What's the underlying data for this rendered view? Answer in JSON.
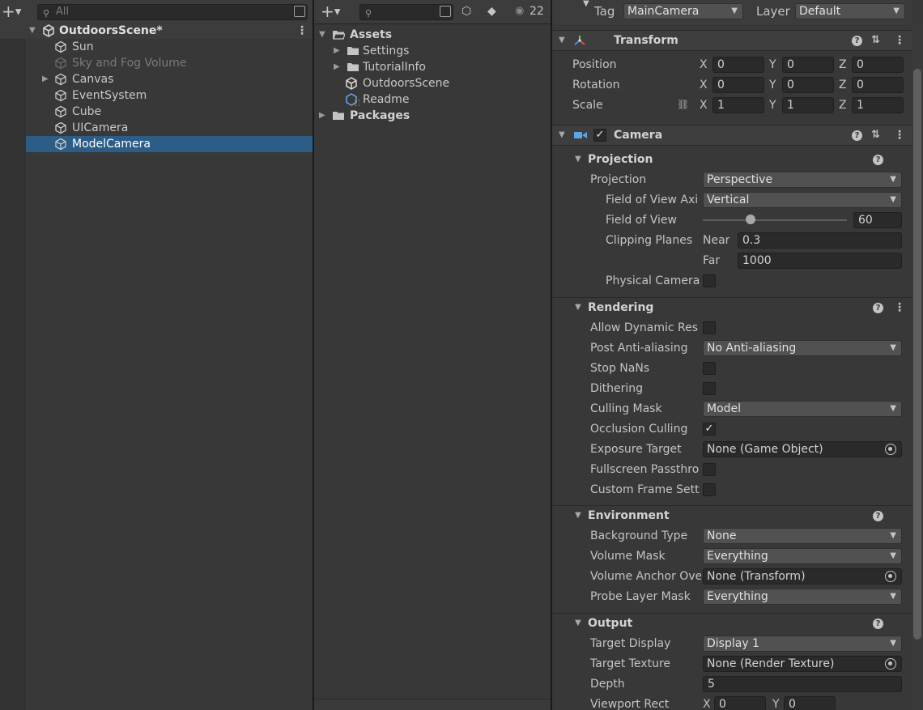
{
  "hierarchy": {
    "search_placeholder": "All",
    "scene": "OutdoorsScene*",
    "items": [
      {
        "label": "Sun",
        "dim": false,
        "has_children": false
      },
      {
        "label": "Sky and Fog Volume",
        "dim": true,
        "has_children": false
      },
      {
        "label": "Canvas",
        "dim": false,
        "has_children": true
      },
      {
        "label": "EventSystem",
        "dim": false,
        "has_children": false
      },
      {
        "label": "Cube",
        "dim": false,
        "has_children": false
      },
      {
        "label": "UICamera",
        "dim": false,
        "has_children": false
      },
      {
        "label": "ModelCamera",
        "dim": false,
        "has_children": false,
        "selected": true
      }
    ]
  },
  "project": {
    "hidden_count": "22",
    "tree": {
      "assets": "Assets",
      "settings": "Settings",
      "tutorialinfo": "TutorialInfo",
      "outdoorsscene": "OutdoorsScene",
      "readme": "Readme",
      "packages": "Packages"
    }
  },
  "inspector": {
    "tag_label": "Tag",
    "tag_value": "MainCamera",
    "layer_label": "Layer",
    "layer_value": "Default",
    "transform": {
      "title": "Transform",
      "position_label": "Position",
      "rotation_label": "Rotation",
      "scale_label": "Scale",
      "axis_x": "X",
      "axis_y": "Y",
      "axis_z": "Z",
      "position": [
        "0",
        "0",
        "0"
      ],
      "rotation": [
        "0",
        "0",
        "0"
      ],
      "scale": [
        "1",
        "1",
        "1"
      ]
    },
    "camera": {
      "title": "Camera",
      "enabled": true,
      "projection": {
        "title": "Projection",
        "projection_label": "Projection",
        "projection_value": "Perspective",
        "fov_axis_label": "Field of View Axi",
        "fov_axis_value": "Vertical",
        "fov_label": "Field of View",
        "fov_value": "60",
        "fov_slider_min": 0,
        "fov_slider_max": 180,
        "clipping_label": "Clipping Planes",
        "near_label": "Near",
        "near_value": "0.3",
        "far_label": "Far",
        "far_value": "1000",
        "physical_label": "Physical Camera",
        "physical_checked": false
      },
      "rendering": {
        "title": "Rendering",
        "allow_dynamic_label": "Allow Dynamic Res",
        "post_aa_label": "Post Anti-aliasing",
        "post_aa_value": "No Anti-aliasing",
        "stop_nans_label": "Stop NaNs",
        "dithering_label": "Dithering",
        "culling_mask_label": "Culling Mask",
        "culling_mask_value": "Model",
        "occlusion_label": "Occlusion Culling",
        "occlusion_checked": true,
        "exposure_label": "Exposure Target",
        "exposure_value": "None (Game Object)",
        "fullscreen_label": "Fullscreen Passthro",
        "custom_frame_label": "Custom Frame Sett"
      },
      "environment": {
        "title": "Environment",
        "bg_type_label": "Background Type",
        "bg_type_value": "None",
        "volume_mask_label": "Volume Mask",
        "volume_mask_value": "Everything",
        "volume_anchor_label": "Volume Anchor Ove",
        "volume_anchor_value": "None (Transform)",
        "probe_layer_label": "Probe Layer Mask",
        "probe_layer_value": "Everything"
      },
      "output": {
        "title": "Output",
        "target_display_label": "Target Display",
        "target_display_value": "Display 1",
        "target_texture_label": "Target Texture",
        "target_texture_value": "None (Render Texture)",
        "depth_label": "Depth",
        "depth_value": "5",
        "viewport_label": "Viewport Rect",
        "viewport_x": "0",
        "viewport_y": "0"
      }
    }
  }
}
